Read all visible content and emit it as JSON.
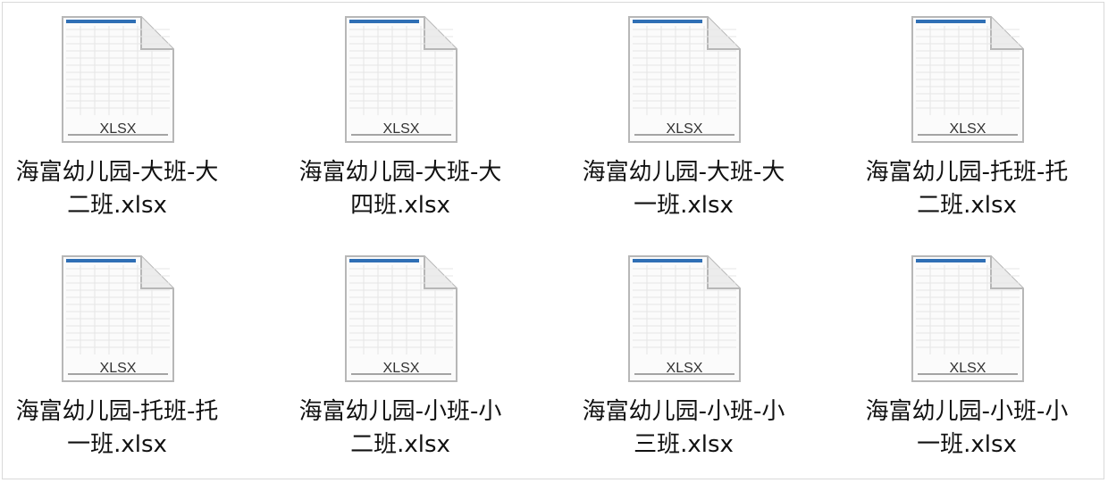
{
  "files": [
    {
      "name_line1": "海富幼儿园-大班-大",
      "name_line2": "二班.xlsx",
      "icon": "xlsx-file-icon",
      "ext_label": "XLSX"
    },
    {
      "name_line1": "海富幼儿园-大班-大",
      "name_line2": "四班.xlsx",
      "icon": "xlsx-file-icon",
      "ext_label": "XLSX"
    },
    {
      "name_line1": "海富幼儿园-大班-大",
      "name_line2": "一班.xlsx",
      "icon": "xlsx-file-icon",
      "ext_label": "XLSX"
    },
    {
      "name_line1": "海富幼儿园-托班-托",
      "name_line2": "二班.xlsx",
      "icon": "xlsx-file-icon",
      "ext_label": "XLSX"
    },
    {
      "name_line1": "海富幼儿园-托班-托",
      "name_line2": "一班.xlsx",
      "icon": "xlsx-file-icon",
      "ext_label": "XLSX"
    },
    {
      "name_line1": "海富幼儿园-小班-小",
      "name_line2": "二班.xlsx",
      "icon": "xlsx-file-icon",
      "ext_label": "XLSX"
    },
    {
      "name_line1": "海富幼儿园-小班-小",
      "name_line2": "三班.xlsx",
      "icon": "xlsx-file-icon",
      "ext_label": "XLSX"
    },
    {
      "name_line1": "海富幼儿园-小班-小",
      "name_line2": "一班.xlsx",
      "icon": "xlsx-file-icon",
      "ext_label": "XLSX"
    }
  ],
  "colors": {
    "icon_header": "#2f6fb5",
    "icon_border": "#a7a7a7",
    "label_text": "#111111"
  }
}
